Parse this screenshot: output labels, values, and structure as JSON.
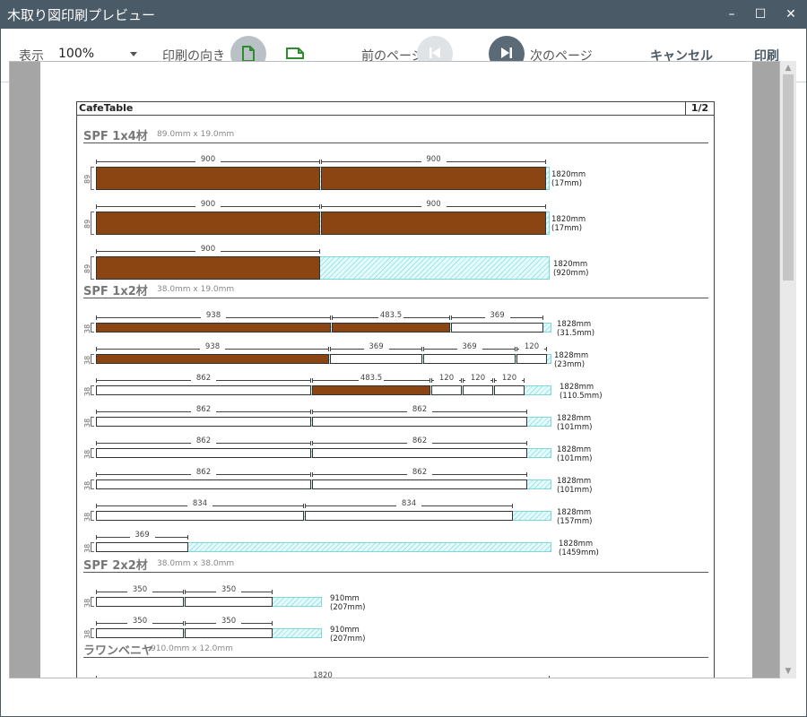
{
  "window": {
    "title": "木取り図印刷プレビュー",
    "minimize": "–",
    "maximize": "☐",
    "close": "✕"
  },
  "toolbar": {
    "zoom_label": "表示",
    "zoom_value": "100%",
    "orientation_label": "印刷の向き",
    "prev_label": "前のページ",
    "next_label": "次のページ",
    "cancel_label": "キャンセル",
    "print_label": "印刷"
  },
  "colors": {
    "wood": "#8b4513",
    "plywood": "#fffacd",
    "accent": "#4a5a66",
    "green": "#2e8b2e"
  },
  "sheet": {
    "name": "CafeTable",
    "page": "1/2"
  },
  "sections": [
    {
      "name": "SPF 1x4材",
      "dims": "89.0mm x 19.0mm"
    },
    {
      "name": "SPF 1x2材",
      "dims": "38.0mm x 19.0mm"
    },
    {
      "name": "SPF 2x2材",
      "dims": "38.0mm x 38.0mm"
    },
    {
      "name": "ラワンベニヤ",
      "dims": "910.0mm x 12.0mm"
    }
  ],
  "boards": [
    {
      "h": "89",
      "pieces": [
        {
          "len": "900",
          "type": "wood"
        },
        {
          "len": "900",
          "type": "wood"
        }
      ],
      "length": "1820mm",
      "remain": "(17mm)"
    },
    {
      "h": "89",
      "pieces": [
        {
          "len": "900",
          "type": "wood"
        },
        {
          "len": "900",
          "type": "wood"
        }
      ],
      "length": "1820mm",
      "remain": "(17mm)"
    },
    {
      "h": "89",
      "pieces": [
        {
          "len": "900",
          "type": "wood"
        }
      ],
      "length": "1820mm",
      "remain": "(920mm)"
    },
    {
      "h": "38",
      "pieces": [
        {
          "len": "938",
          "type": "wood"
        },
        {
          "len": "483.5",
          "type": "wood"
        },
        {
          "len": "369",
          "type": "plain"
        }
      ],
      "length": "1828mm",
      "remain": "(31.5mm)"
    },
    {
      "h": "38",
      "pieces": [
        {
          "len": "938",
          "type": "wood"
        },
        {
          "len": "369",
          "type": "plain"
        },
        {
          "len": "369",
          "type": "plain"
        },
        {
          "len": "120",
          "type": "plain"
        }
      ],
      "length": "1828mm",
      "remain": "(23mm)"
    },
    {
      "h": "38",
      "pieces": [
        {
          "len": "862",
          "type": "plain"
        },
        {
          "len": "483.5",
          "type": "wood"
        },
        {
          "len": "120",
          "type": "plain"
        },
        {
          "len": "120",
          "type": "plain"
        },
        {
          "len": "120",
          "type": "plain"
        }
      ],
      "length": "1828mm",
      "remain": "(110.5mm)"
    },
    {
      "h": "38",
      "pieces": [
        {
          "len": "862",
          "type": "plain"
        },
        {
          "len": "862",
          "type": "plain"
        }
      ],
      "length": "1828mm",
      "remain": "(101mm)"
    },
    {
      "h": "38",
      "pieces": [
        {
          "len": "862",
          "type": "plain"
        },
        {
          "len": "862",
          "type": "plain"
        }
      ],
      "length": "1828mm",
      "remain": "(101mm)"
    },
    {
      "h": "38",
      "pieces": [
        {
          "len": "862",
          "type": "plain"
        },
        {
          "len": "862",
          "type": "plain"
        }
      ],
      "length": "1828mm",
      "remain": "(101mm)"
    },
    {
      "h": "38",
      "pieces": [
        {
          "len": "834",
          "type": "plain"
        },
        {
          "len": "834",
          "type": "plain"
        }
      ],
      "length": "1828mm",
      "remain": "(157mm)"
    },
    {
      "h": "38",
      "pieces": [
        {
          "len": "369",
          "type": "plain"
        }
      ],
      "length": "1828mm",
      "remain": "(1459mm)"
    },
    {
      "h": "38",
      "pieces": [
        {
          "len": "350",
          "type": "plain"
        },
        {
          "len": "350",
          "type": "plain"
        }
      ],
      "length": "910mm",
      "remain": "(207mm)"
    },
    {
      "h": "38",
      "pieces": [
        {
          "len": "350",
          "type": "plain"
        },
        {
          "len": "350",
          "type": "plain"
        }
      ],
      "length": "910mm",
      "remain": "(207mm)"
    },
    {
      "h": "",
      "pieces": [
        {
          "len": "",
          "type": "ply"
        }
      ],
      "length": "",
      "remain": "",
      "dim_label": "1820"
    }
  ]
}
